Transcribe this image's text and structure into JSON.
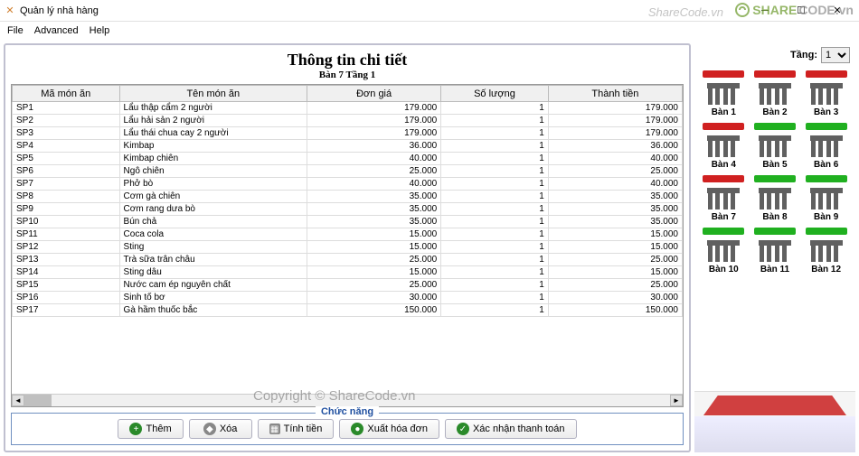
{
  "window": {
    "title": "Quản lý nhà hàng"
  },
  "menu": {
    "file": "File",
    "advanced": "Advanced",
    "help": "Help"
  },
  "detail": {
    "title": "Thông tin chi tiết",
    "subtitle": "Bàn 7 Tầng 1"
  },
  "columns": {
    "id": "Mã món ăn",
    "name": "Tên món ăn",
    "price": "Đơn giá",
    "qty": "Số lượng",
    "total": "Thành tiền"
  },
  "rows": [
    {
      "id": "SP1",
      "name": "Lẩu thập cẩm 2 người",
      "price": "179.000",
      "qty": "1",
      "total": "179.000"
    },
    {
      "id": "SP2",
      "name": "Lẩu hải sản 2 người",
      "price": "179.000",
      "qty": "1",
      "total": "179.000"
    },
    {
      "id": "SP3",
      "name": "Lẩu thái chua cay 2 người",
      "price": "179.000",
      "qty": "1",
      "total": "179.000"
    },
    {
      "id": "SP4",
      "name": "Kimbap",
      "price": "36.000",
      "qty": "1",
      "total": "36.000"
    },
    {
      "id": "SP5",
      "name": "Kimbap chiên",
      "price": "40.000",
      "qty": "1",
      "total": "40.000"
    },
    {
      "id": "SP6",
      "name": "Ngô chiên",
      "price": "25.000",
      "qty": "1",
      "total": "25.000"
    },
    {
      "id": "SP7",
      "name": "Phở bò",
      "price": "40.000",
      "qty": "1",
      "total": "40.000"
    },
    {
      "id": "SP8",
      "name": "Cơm gà chiên",
      "price": "35.000",
      "qty": "1",
      "total": "35.000"
    },
    {
      "id": "SP9",
      "name": "Cơm rang dưa bò",
      "price": "35.000",
      "qty": "1",
      "total": "35.000"
    },
    {
      "id": "SP10",
      "name": "Bún chả",
      "price": "35.000",
      "qty": "1",
      "total": "35.000"
    },
    {
      "id": "SP11",
      "name": "Coca cola",
      "price": "15.000",
      "qty": "1",
      "total": "15.000"
    },
    {
      "id": "SP12",
      "name": "Sting",
      "price": "15.000",
      "qty": "1",
      "total": "15.000"
    },
    {
      "id": "SP13",
      "name": "Trà sữa trân châu",
      "price": "25.000",
      "qty": "1",
      "total": "25.000"
    },
    {
      "id": "SP14",
      "name": "Sting dâu",
      "price": "15.000",
      "qty": "1",
      "total": "15.000"
    },
    {
      "id": "SP15",
      "name": "Nước cam ép nguyên chất",
      "price": "25.000",
      "qty": "1",
      "total": "25.000"
    },
    {
      "id": "SP16",
      "name": "Sinh tố bơ",
      "price": "30.000",
      "qty": "1",
      "total": "30.000"
    },
    {
      "id": "SP17",
      "name": "Gà hầm thuốc bắc",
      "price": "150.000",
      "qty": "1",
      "total": "150.000"
    }
  ],
  "functions": {
    "legend": "Chức năng",
    "add": "Thêm",
    "delete": "Xóa",
    "calc": "Tính tiền",
    "export": "Xuất hóa đơn",
    "confirm": "Xác nhận thanh toán"
  },
  "floor": {
    "label": "Tầng:",
    "value": "1"
  },
  "tables": [
    {
      "label": "Bàn 1",
      "status": "red"
    },
    {
      "label": "Bàn 2",
      "status": "red"
    },
    {
      "label": "Bàn 3",
      "status": "red"
    },
    {
      "label": "Bàn 4",
      "status": "red"
    },
    {
      "label": "Bàn 5",
      "status": "green"
    },
    {
      "label": "Bàn 6",
      "status": "green"
    },
    {
      "label": "Bàn 7",
      "status": "red"
    },
    {
      "label": "Bàn 8",
      "status": "green"
    },
    {
      "label": "Bàn 9",
      "status": "green"
    },
    {
      "label": "Bàn 10",
      "status": "green"
    },
    {
      "label": "Bàn 11",
      "status": "green"
    },
    {
      "label": "Bàn 12",
      "status": "green"
    }
  ],
  "watermark": {
    "logo1": "SHARE",
    "logo2": "CODE.vn",
    "top": "ShareCode.vn",
    "center": "Copyright © ShareCode.vn"
  }
}
